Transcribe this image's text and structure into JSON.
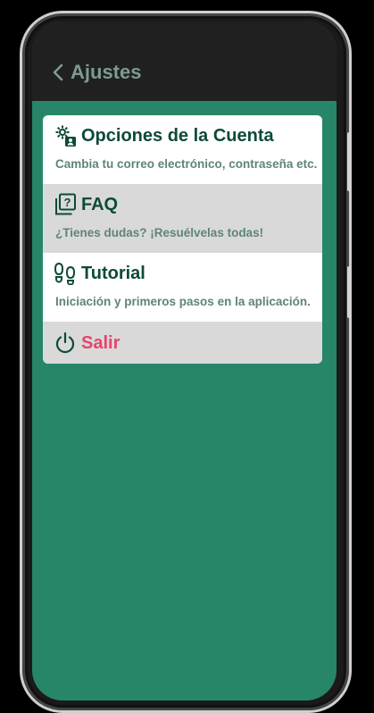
{
  "appbar": {
    "title": "Ajustes",
    "back_icon": "chevron-left-icon"
  },
  "menu": {
    "items": [
      {
        "title": "Opciones de la Cuenta",
        "subtitle": "Cambia tu correo electrónico, contraseña etc.",
        "icon": "account-settings-icon"
      },
      {
        "title": "FAQ",
        "subtitle": "¿Tienes dudas? ¡Resuélvelas todas!",
        "icon": "faq-icon"
      },
      {
        "title": "Tutorial",
        "subtitle": "Iniciación y primeros pasos en la aplicación.",
        "icon": "footsteps-icon"
      },
      {
        "title": "Salir",
        "icon": "power-icon"
      }
    ]
  },
  "colors": {
    "background": "#27856a",
    "appbar": "#202020",
    "title_text": "#0d4a3a",
    "subtitle_text": "#5e847a",
    "logout": "#e8436b",
    "alt_row": "#d9d9d9"
  }
}
